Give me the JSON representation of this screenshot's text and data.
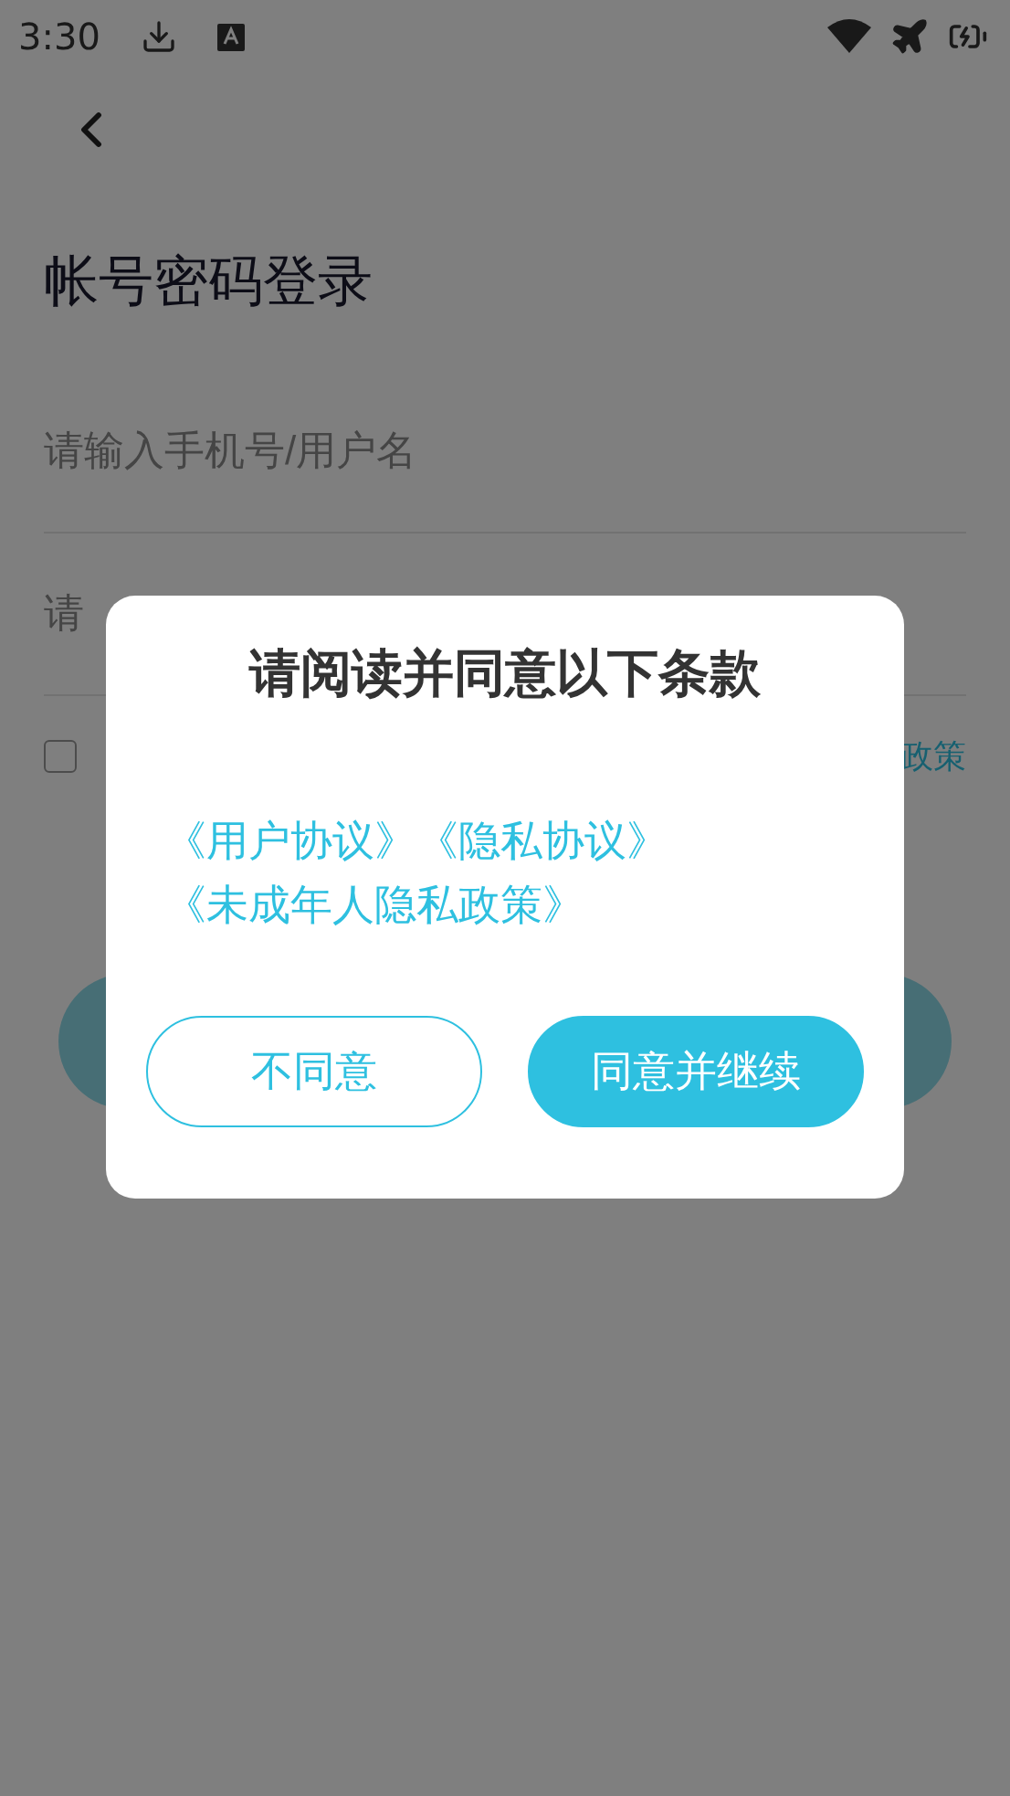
{
  "status_bar": {
    "time": "3:30"
  },
  "page": {
    "title": "帐号密码登录",
    "username": {
      "placeholder": "请输入手机号/用户名"
    },
    "password": {
      "placeholder": "请"
    },
    "agreement": {
      "checked": false,
      "end": "政策"
    }
  },
  "dialog": {
    "title": "请阅读并同意以下条款",
    "links": [
      "《用户协议》",
      "《隐私协议》",
      "《未成年人隐私政策》"
    ],
    "buttons": [
      {
        "label": "不同意",
        "kind": "outline"
      },
      {
        "label": "同意并继续",
        "kind": "filled"
      }
    ]
  }
}
